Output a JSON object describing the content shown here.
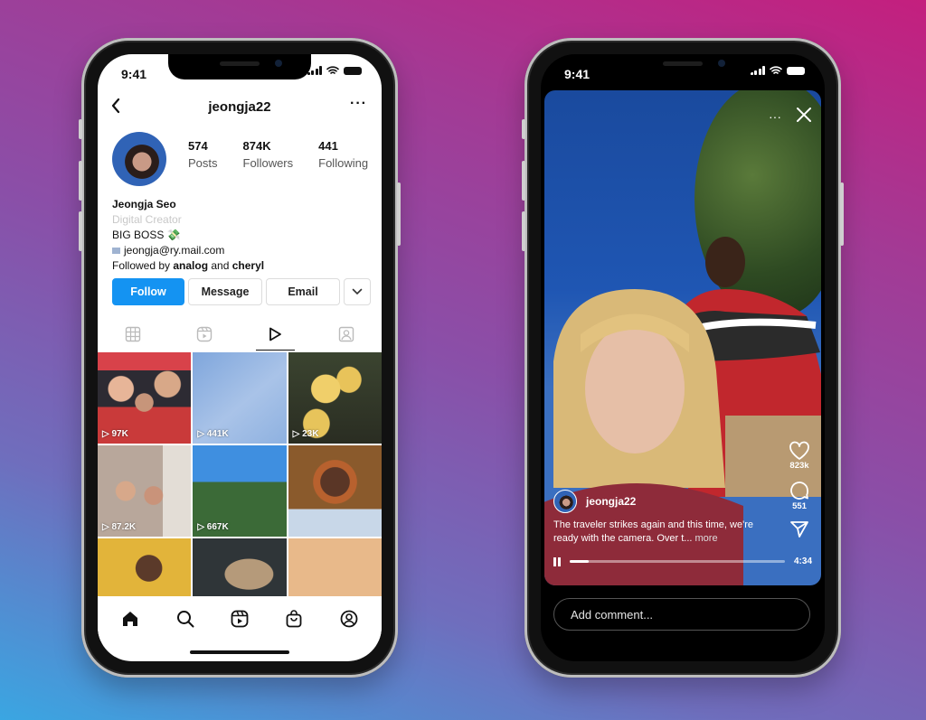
{
  "background": {
    "gradient_colors": [
      "#c41f7e",
      "#8a4fa8",
      "#3aa6e2"
    ]
  },
  "profile_phone": {
    "status_bar": {
      "time": "9:41"
    },
    "header": {
      "back_icon": "chevron-left-icon",
      "username": "jeongja22",
      "more_icon": "ellipsis-icon",
      "more_label": "···"
    },
    "stats": [
      {
        "value": "574",
        "label": "Posts"
      },
      {
        "value": "874K",
        "label": "Followers"
      },
      {
        "value": "441",
        "label": "Following"
      }
    ],
    "bio": {
      "name": "Jeongja Seo",
      "category": "Digital Creator",
      "line1": "BIG BOSS 💸",
      "email": "jeongja@ry.mail.com",
      "followed_by_prefix": "Followed by ",
      "followed_by_user1": "analog",
      "followed_by_and": " and ",
      "followed_by_user2": "cheryl"
    },
    "actions": {
      "follow": "Follow",
      "message": "Message",
      "email": "Email",
      "dropdown_icon": "chevron-down-icon"
    },
    "tabs": [
      {
        "name": "grid",
        "icon": "grid-icon",
        "active": false
      },
      {
        "name": "reels",
        "icon": "reels-icon",
        "active": false
      },
      {
        "name": "videos",
        "icon": "play-icon",
        "active": true
      },
      {
        "name": "tagged",
        "icon": "tagged-user-icon",
        "active": false
      }
    ],
    "grid": [
      {
        "views": "97K"
      },
      {
        "views": "441K"
      },
      {
        "views": "23K"
      },
      {
        "views": "87.2K"
      },
      {
        "views": "667K"
      },
      {
        "views": ""
      },
      {
        "views": ""
      },
      {
        "views": ""
      },
      {
        "views": ""
      }
    ],
    "bottom_nav": [
      "home-icon",
      "search-icon",
      "reels-icon",
      "shop-icon",
      "profile-icon"
    ],
    "accent": "#1493f2"
  },
  "reel_phone": {
    "status_bar": {
      "time": "9:41"
    },
    "top_controls": {
      "more_label": "···",
      "close_label": "✕"
    },
    "side_actions": {
      "likes": "823k",
      "comments": "551"
    },
    "owner": {
      "username": "jeongja22"
    },
    "caption": {
      "text": "The traveler strikes again and this time, we're ready with the camera. Over t...",
      "more": "more"
    },
    "player": {
      "progress": 0.09,
      "remaining": "4:34"
    },
    "comment": {
      "placeholder": "Add comment..."
    }
  }
}
